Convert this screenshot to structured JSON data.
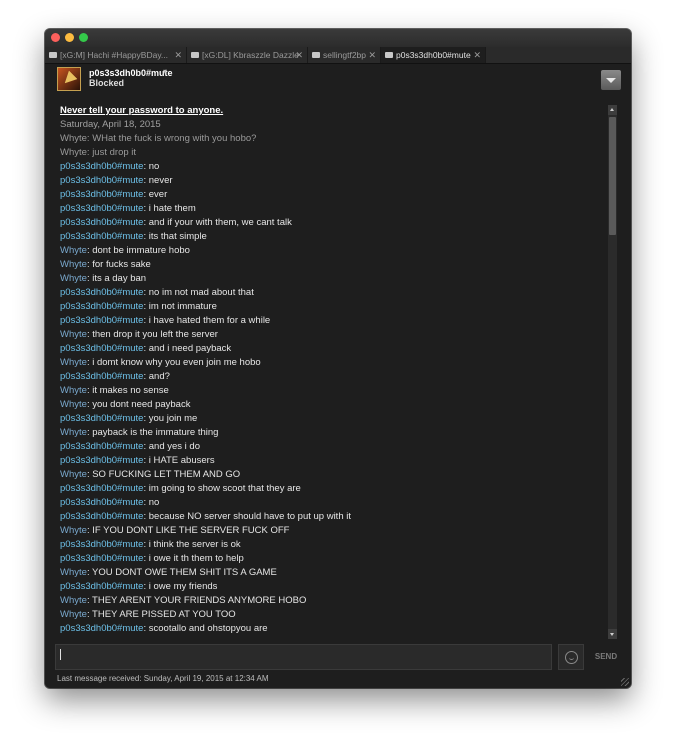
{
  "tabs": [
    {
      "label": "[xG:M] Hachi #HappyBDay..."
    },
    {
      "label": "[xG:DL] Kbraszzle Dazzle"
    },
    {
      "label": "sellingtf2bp"
    },
    {
      "label": "p0s3s3dh0b0#mute"
    }
  ],
  "header": {
    "contact_name": "p0s3s3dh0b0#mute",
    "status": "Blocked"
  },
  "chat": {
    "warning": "Never tell your password to anyone.",
    "date": "Saturday, April 18, 2015",
    "old_messages": [
      "Whyte: WHat the fuck is wrong with you hobo?",
      "Whyte: just drop it"
    ],
    "messages": [
      {
        "sender": "p0s3s3dh0b0#mute",
        "text": ": no"
      },
      {
        "sender": "p0s3s3dh0b0#mute",
        "text": ": never"
      },
      {
        "sender": "p0s3s3dh0b0#mute",
        "text": ": ever"
      },
      {
        "sender": "p0s3s3dh0b0#mute",
        "text": ": i hate them"
      },
      {
        "sender": "p0s3s3dh0b0#mute",
        "text": ": and if your with them, we cant talk"
      },
      {
        "sender": "p0s3s3dh0b0#mute",
        "text": ": its that simple"
      },
      {
        "sender": "Whyte",
        "text": ": dont be immature hobo"
      },
      {
        "sender": "Whyte",
        "text": ": for fucks sake"
      },
      {
        "sender": "Whyte",
        "text": ": its a day ban"
      },
      {
        "sender": "p0s3s3dh0b0#mute",
        "text": ": no im not mad about that"
      },
      {
        "sender": "p0s3s3dh0b0#mute",
        "text": ": im not immature"
      },
      {
        "sender": "p0s3s3dh0b0#mute",
        "text": ": i have hated them for a while"
      },
      {
        "sender": "Whyte",
        "text": ": then drop it you left the server"
      },
      {
        "sender": "p0s3s3dh0b0#mute",
        "text": ": and i need payback"
      },
      {
        "sender": "Whyte",
        "text": ": i domt know why you even join me hobo"
      },
      {
        "sender": "p0s3s3dh0b0#mute",
        "text": ": and?"
      },
      {
        "sender": "Whyte",
        "text": ": it makes no sense"
      },
      {
        "sender": "Whyte",
        "text": ": you dont need payback"
      },
      {
        "sender": "p0s3s3dh0b0#mute",
        "text": ": you join me"
      },
      {
        "sender": "Whyte",
        "text": ": payback is the immature thing"
      },
      {
        "sender": "p0s3s3dh0b0#mute",
        "text": ": and yes i do"
      },
      {
        "sender": "p0s3s3dh0b0#mute",
        "text": ": i HATE abusers"
      },
      {
        "sender": "Whyte",
        "text": ": SO FUCKING LET THEM AND GO"
      },
      {
        "sender": "p0s3s3dh0b0#mute",
        "text": ": im going to show scoot that they are"
      },
      {
        "sender": "p0s3s3dh0b0#mute",
        "text": ": no"
      },
      {
        "sender": "p0s3s3dh0b0#mute",
        "text": ": because NO server should have to put up with it"
      },
      {
        "sender": "Whyte",
        "text": ": IF YOU DONT LIKE THE SERVER FUCK OFF"
      },
      {
        "sender": "p0s3s3dh0b0#mute",
        "text": ": i think the server is ok"
      },
      {
        "sender": "p0s3s3dh0b0#mute",
        "text": ": i owe it th them to help"
      },
      {
        "sender": "Whyte",
        "text": ": YOU DONT OWE THEM SHIT ITS A GAME"
      },
      {
        "sender": "p0s3s3dh0b0#mute",
        "text": ": i owe my friends"
      },
      {
        "sender": "Whyte",
        "text": ": THEY ARENT YOUR FRIENDS ANYMORE HOBO"
      },
      {
        "sender": "Whyte",
        "text": ": THEY ARE PISSED AT YOU TOO"
      },
      {
        "sender": "p0s3s3dh0b0#mute",
        "text": ": scootallo and ohstopyou are"
      }
    ]
  },
  "composer": {
    "send_label": "SEND"
  },
  "statusbar": {
    "last_message": "Last message received: Sunday, April 19, 2015 at 12:34 AM"
  },
  "colors": {
    "self_name": "#6dc0e8",
    "other_name": "#7aa9ce",
    "background": "#1e1e1e"
  },
  "icons": {
    "tab": "chat-bubble-icon",
    "close": "close-icon",
    "dropdown": "chevron-down-icon",
    "menu": "menu-triangle-icon",
    "emoji": "smiley-icon"
  }
}
